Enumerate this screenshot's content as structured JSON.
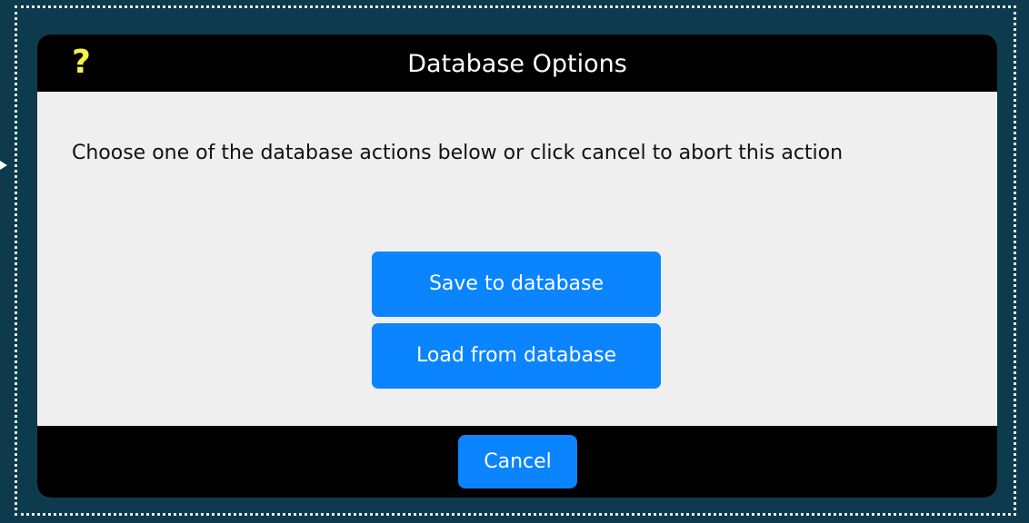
{
  "dialog": {
    "title": "Database Options",
    "help_icon_glyph": "?",
    "help_icon": "question-mark-icon",
    "message": "Choose one of the database actions below or click cancel to abort this action",
    "actions": [
      {
        "label": "Save to database"
      },
      {
        "label": "Load from database"
      }
    ],
    "cancel_label": "Cancel"
  },
  "colors": {
    "background": "#0d3b4d",
    "titlebar": "#000000",
    "dialog_body": "#efefef",
    "button": "#0a84ff",
    "help_icon": "#f5f04a"
  }
}
